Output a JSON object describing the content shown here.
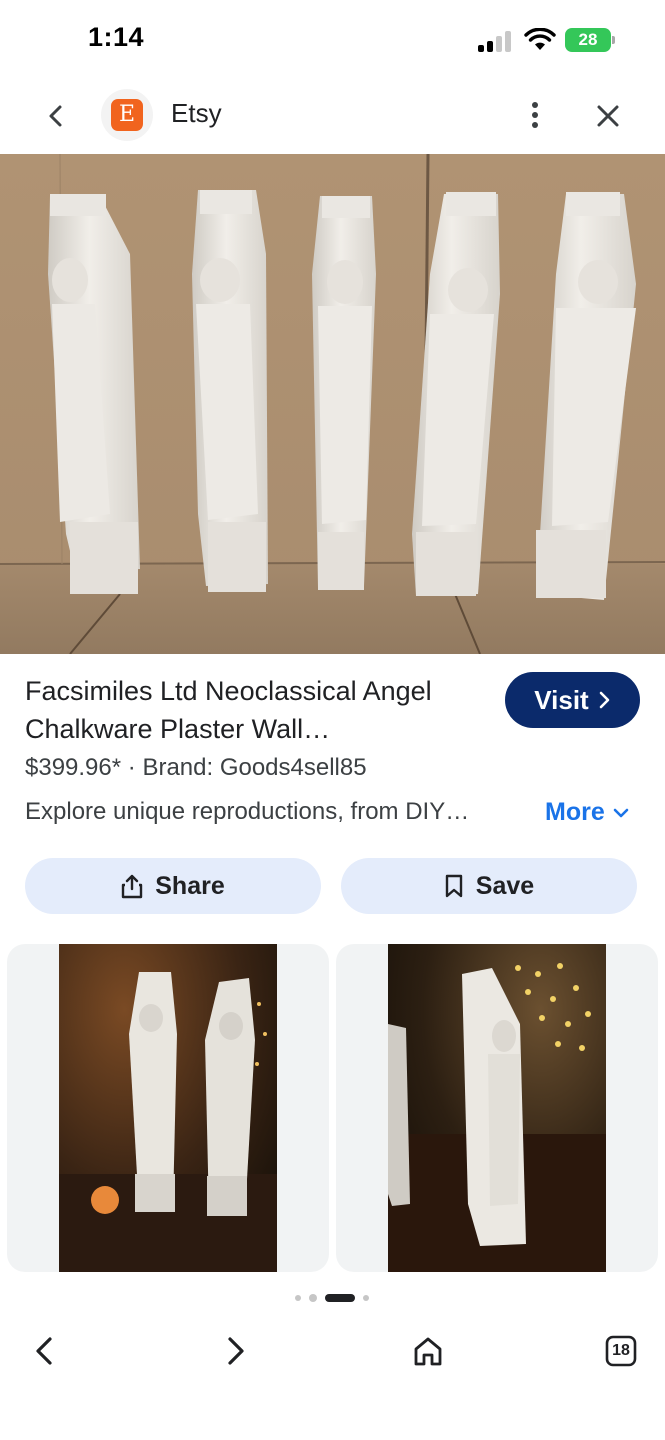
{
  "status_bar": {
    "time": "1:14",
    "battery": "28",
    "icons": [
      "signal-icon",
      "wifi-icon",
      "battery-charging-icon"
    ]
  },
  "header": {
    "site_logo_letter": "E",
    "site_name": "Etsy",
    "icons": [
      "back-arrow-icon",
      "more-vert-icon",
      "close-icon"
    ],
    "logo_color": "#f1641e"
  },
  "product": {
    "title": "Facsimiles Ltd Neoclassical Angel Chalkware Plaster Wall…",
    "visit_label": "Visit",
    "price": "$399.96*",
    "separator": "·",
    "brand": "Brand: Goods4sell85",
    "description": "Explore unique reproductions, from DIY…",
    "more_label": "More",
    "share_label": "Share",
    "save_label": "Save",
    "accent_color": "#1a73e8",
    "visit_color": "#0b2a6b"
  },
  "related": {
    "cards": [
      {
        "icon": "related-image-1"
      },
      {
        "icon": "related-image-2"
      }
    ]
  },
  "pagination": {
    "count": 4,
    "active": 2
  },
  "bottom_nav": {
    "tab_count": "18",
    "icons": [
      "nav-back-icon",
      "nav-forward-icon",
      "home-icon",
      "tabs-icon"
    ]
  }
}
